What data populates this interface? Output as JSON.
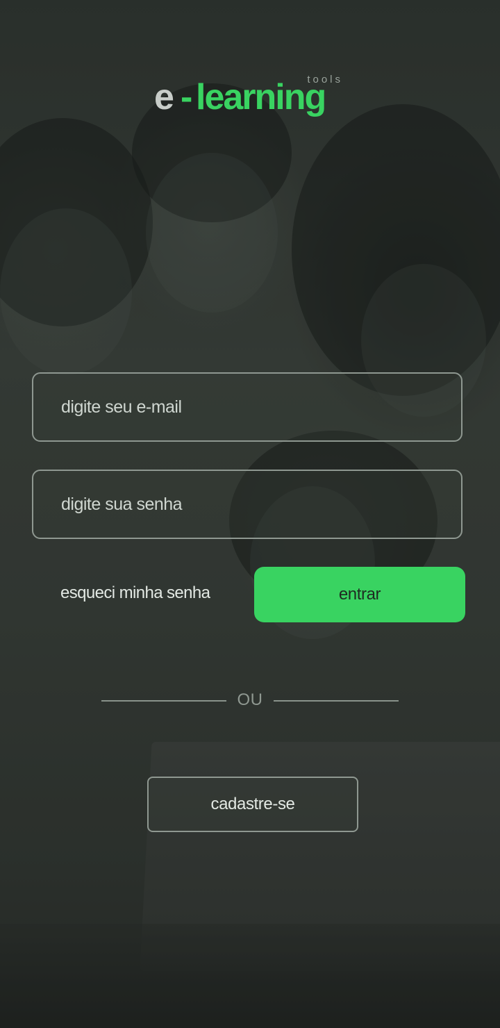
{
  "logo": {
    "prefix": "e",
    "dash": "-",
    "word": "learning",
    "tag": "tools",
    "colors": {
      "prefix": "#c8cdc9",
      "word": "#39d361"
    }
  },
  "form": {
    "email": {
      "placeholder": "digite seu e-mail",
      "value": ""
    },
    "password": {
      "placeholder": "digite sua senha",
      "value": ""
    },
    "forgot_label": "esqueci minha senha",
    "submit_label": "entrar"
  },
  "divider": {
    "label": "OU"
  },
  "signup": {
    "label": "cadastre-se"
  },
  "theme": {
    "accent": "#39d361",
    "background": "#2f3430"
  }
}
